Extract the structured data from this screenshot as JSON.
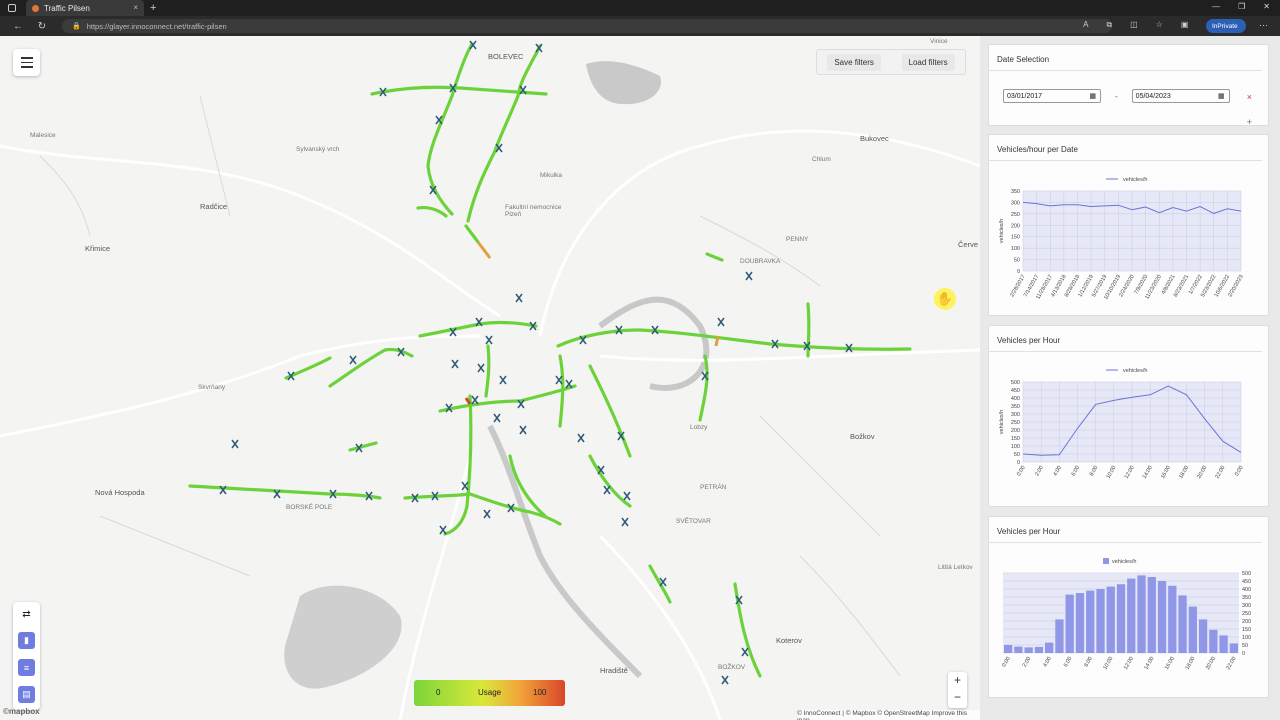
{
  "browser": {
    "tab_title": "Traffic Pilsen",
    "tab_close": "×",
    "new_tab": "+",
    "url": "https://glayer.innoconnect.net/traffic-pilsen",
    "inprivate": "InPrivate"
  },
  "map": {
    "save_filters": "Save filters",
    "load_filters": "Load filters",
    "legend": {
      "min": "0",
      "label": "Usage",
      "max": "100"
    },
    "zoom_in": "+",
    "zoom_out": "−",
    "attribution": "© InnoConnect | © Mapbox © OpenStreetMap  Improve this map",
    "logo": "©mapbox",
    "places": [
      "BOLEVEC",
      "Malesice",
      "Radčice",
      "Křimice",
      "Sylvanský vrch",
      "Mikulka",
      "Fakultní nemocnice Plzeň",
      "DOUBRAVKA",
      "PENNY",
      "Bukovec",
      "Chlum",
      "Červe",
      "Nová Hospoda",
      "BORSKÉ POLE",
      "Božkov",
      "PETRÁN",
      "SVĚTOVAR",
      "Koterov",
      "Hradiště",
      "Lobzy",
      "BOŽKOV",
      "Vinice",
      "Skvrňany",
      "Lititá Letkov"
    ]
  },
  "panel": {
    "date_selection": {
      "title": "Date Selection",
      "start": "03/01/2017",
      "end": "05/04/2023",
      "separator": "-",
      "clear": "×",
      "add": "+"
    }
  },
  "chart_data": [
    {
      "type": "line",
      "title": "Vehicles/hour per Date",
      "legend": "vehicles/h",
      "ylabel": "vehicles/h",
      "ylim": [
        0,
        350
      ],
      "yticks": [
        0,
        50,
        100,
        150,
        200,
        250,
        300,
        350
      ],
      "x": [
        "2/28/2017",
        "7/14/2017",
        "11/28/2017",
        "4/13/2018",
        "8/28/2018",
        "1/12/2019",
        "5/27/2019",
        "10/10/2019",
        "2/24/2020",
        "7/9/2020",
        "11/23/2020",
        "4/8/2021",
        "8/23/2021",
        "1/7/2022",
        "5/23/2022",
        "10/6/2022",
        "2/20/2023"
      ],
      "values": [
        300,
        295,
        285,
        290,
        290,
        282,
        285,
        288,
        268,
        280,
        255,
        278,
        262,
        282,
        252,
        272,
        262
      ]
    },
    {
      "type": "line",
      "title": "Vehicles per Hour",
      "legend": "vehicles/h",
      "ylabel": "vehicles/h",
      "ylim": [
        0,
        500
      ],
      "yticks": [
        0,
        50,
        100,
        150,
        200,
        250,
        300,
        350,
        400,
        450,
        500
      ],
      "x": [
        "0:00",
        "2:00",
        "4:00",
        "6:00",
        "8:00",
        "10:00",
        "12:00",
        "14:00",
        "16:00",
        "18:00",
        "20:00",
        "22:00",
        "0:00"
      ],
      "values": [
        50,
        42,
        45,
        210,
        360,
        385,
        405,
        420,
        475,
        420,
        270,
        130,
        60
      ]
    },
    {
      "type": "bar",
      "title": "Vehicles per Hour",
      "legend": "vehicles/h",
      "ylim": [
        0,
        500
      ],
      "yticks": [
        0,
        50,
        100,
        150,
        200,
        250,
        300,
        350,
        400,
        450,
        500
      ],
      "categories": [
        "0:00",
        "",
        "2:00",
        "",
        "4:00",
        "",
        "6:00",
        "",
        "8:00",
        "",
        "10:00",
        "",
        "12:00",
        "",
        "14:00",
        "",
        "16:00",
        "",
        "18:00",
        "",
        "20:00",
        "",
        "22:00",
        ""
      ],
      "values": [
        50,
        40,
        35,
        38,
        65,
        210,
        365,
        375,
        390,
        400,
        415,
        430,
        465,
        485,
        475,
        450,
        420,
        360,
        290,
        210,
        145,
        110,
        60
      ]
    }
  ]
}
